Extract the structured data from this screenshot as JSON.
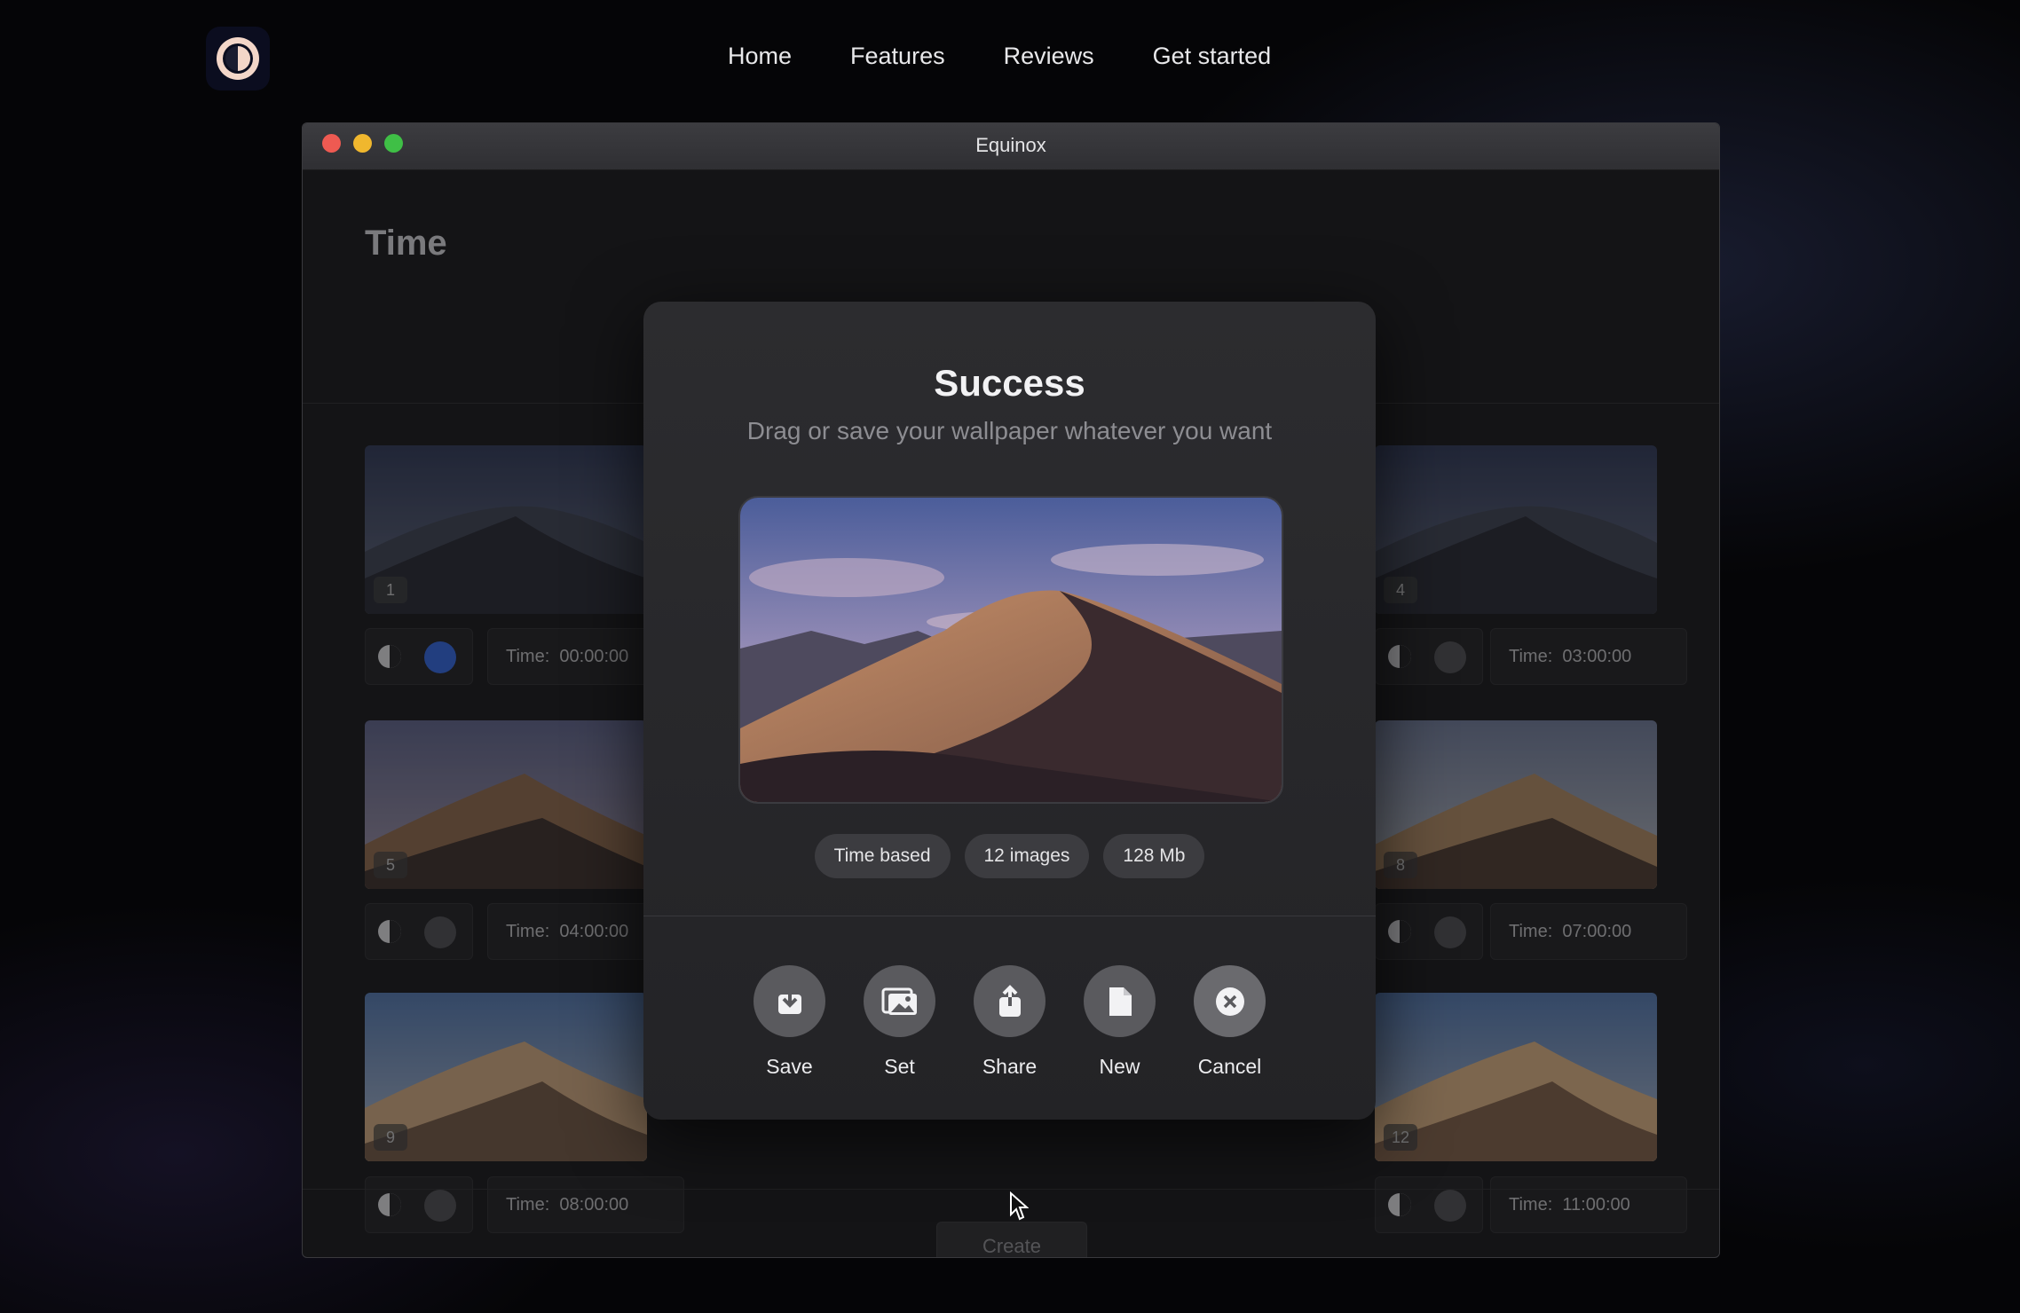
{
  "nav": {
    "logo_icon": "equinox-logo-icon",
    "items": [
      "Home",
      "Features",
      "Reviews",
      "Get started"
    ]
  },
  "window": {
    "title": "Equinox",
    "section_title": "Time",
    "create_label": "Create"
  },
  "tiles": [
    {
      "num": "1",
      "time_label": "Time:",
      "time": "00:00:00",
      "selected": true
    },
    {
      "num": "4",
      "time_label": "Time:",
      "time": "03:00:00",
      "selected": false
    },
    {
      "num": "5",
      "time_label": "Time:",
      "time": "04:00:00",
      "selected": false
    },
    {
      "num": "8",
      "time_label": "Time:",
      "time": "07:00:00",
      "selected": false
    },
    {
      "num": "9",
      "time_label": "Time:",
      "time": "08:00:00",
      "selected": false
    },
    {
      "num": "12",
      "time_label": "Time:",
      "time": "11:00:00",
      "selected": false
    }
  ],
  "modal": {
    "title": "Success",
    "subtitle": "Drag or save your wallpaper whatever you want",
    "badges": [
      "Time based",
      "12 images",
      "128 Mb"
    ],
    "actions": [
      {
        "label": "Save",
        "icon": "save-icon"
      },
      {
        "label": "Set",
        "icon": "image-icon"
      },
      {
        "label": "Share",
        "icon": "share-icon"
      },
      {
        "label": "New",
        "icon": "new-file-icon"
      },
      {
        "label": "Cancel",
        "icon": "close-icon"
      }
    ]
  },
  "colors": {
    "accent_blue": "#2e62d6",
    "close_red": "#ee5a52",
    "minimize_yellow": "#f0b72e",
    "maximize_green": "#3fbf46"
  }
}
